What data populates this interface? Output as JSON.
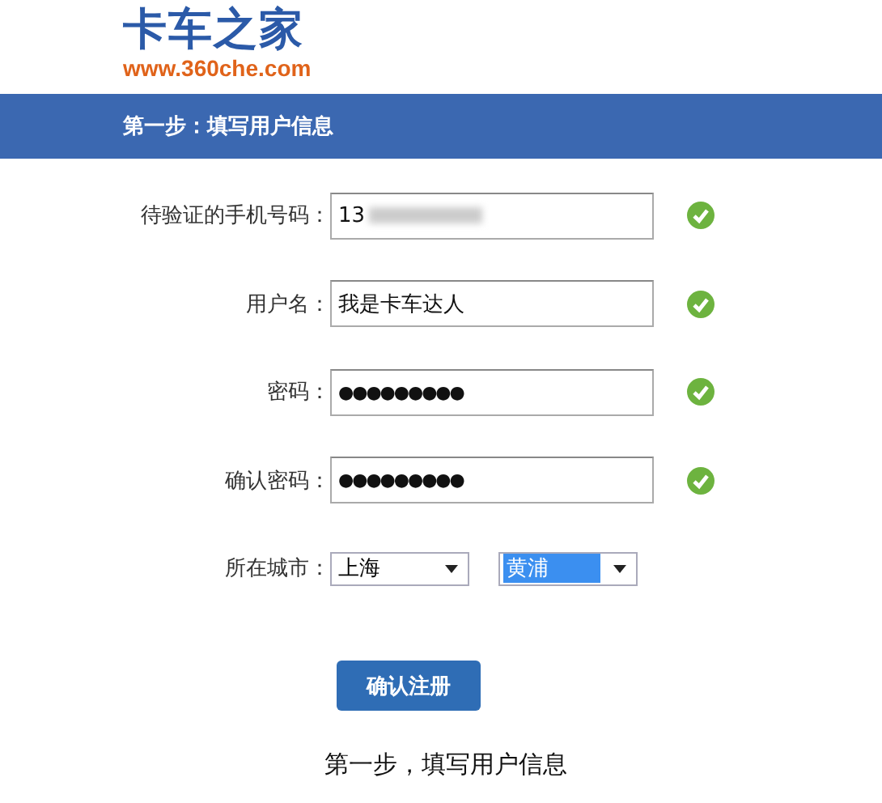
{
  "logo": {
    "name": "卡车之家",
    "url": "www.360che.com"
  },
  "step_bar": {
    "title": "第一步：填写用户信息"
  },
  "fields": [
    {
      "label": "待验证的手机号码：",
      "value": "13",
      "kind": "blurred",
      "valid": true
    },
    {
      "label": "用户名：",
      "value": "我是卡车达人",
      "kind": "text",
      "valid": true
    },
    {
      "label": "密码：",
      "value": "●●●●●●●●●",
      "kind": "password",
      "valid": true
    },
    {
      "label": "确认密码：",
      "value": "●●●●●●●●●",
      "kind": "password",
      "valid": true
    }
  ],
  "city": {
    "label": "所在城市：",
    "selects": [
      {
        "value": "上海",
        "highlighted": false
      },
      {
        "value": "黄浦",
        "highlighted": true
      }
    ]
  },
  "submit_button": "确认注册",
  "footer": "第一步，填写用户信息"
}
